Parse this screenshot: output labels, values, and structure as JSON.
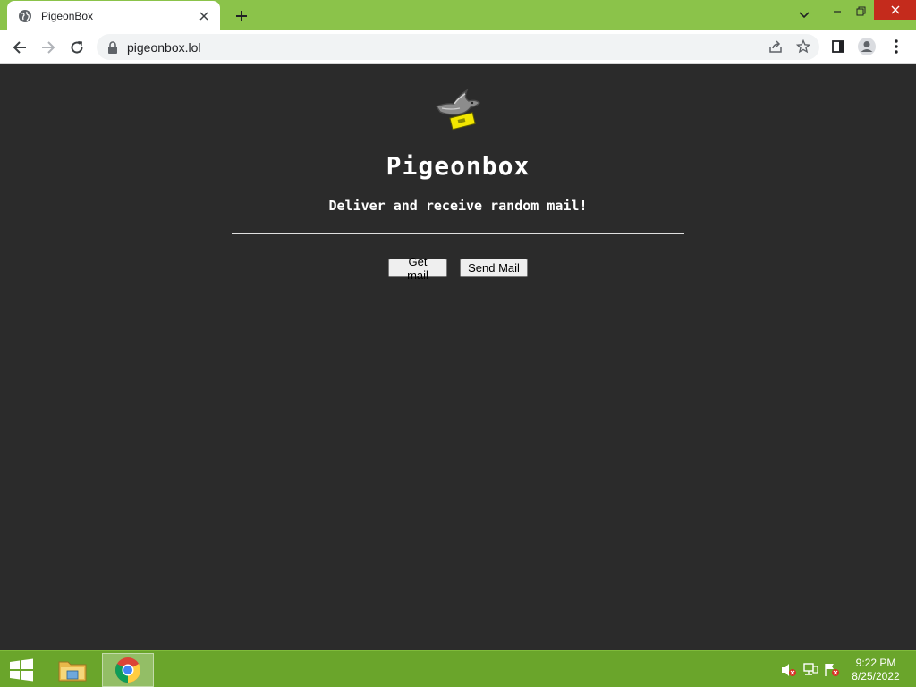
{
  "browser": {
    "tab_title": "PigeonBox",
    "url": "pigeonbox.lol"
  },
  "page": {
    "logo_icon": "pigeon-with-letter-icon",
    "title": "Pigeonbox",
    "tagline": "Deliver and receive random mail!",
    "buttons": {
      "get_mail": "Get mail",
      "send_mail": "Send Mail"
    }
  },
  "taskbar": {
    "time": "9:22 PM",
    "date": "8/25/2022"
  },
  "colors": {
    "tabstrip": "#8bc34a",
    "page_background": "#2b2b2b",
    "taskbar": "#6aa52b",
    "close_button": "#c42b1c",
    "letter_yellow": "#f2e600"
  }
}
